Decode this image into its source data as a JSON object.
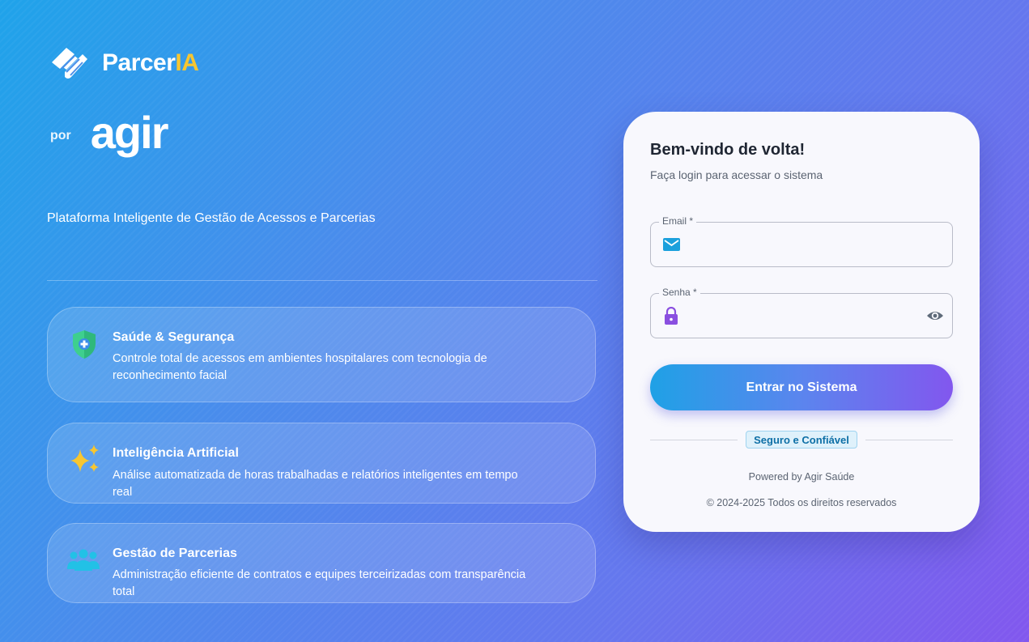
{
  "brand": {
    "name_main": "Parcer",
    "name_accent": "IA",
    "by_label": "por",
    "partner": "agir",
    "tagline": "Plataforma Inteligente de Gestão de Acessos e Parcerias"
  },
  "features": [
    {
      "icon": "shield-plus-icon",
      "title": "Saúde & Segurança",
      "description": "Controle total de acessos em ambientes hospitalares com tecnologia de reconhecimento facial"
    },
    {
      "icon": "sparkles-icon",
      "title": "Inteligência Artificial",
      "description": "Análise automatizada de horas trabalhadas e relatórios inteligentes em tempo real"
    },
    {
      "icon": "people-group-icon",
      "title": "Gestão de Parcerias",
      "description": "Administração eficiente de contratos e equipes terceirizadas com transparência total"
    }
  ],
  "login": {
    "title": "Bem-vindo de volta!",
    "subtitle": "Faça login para acessar o sistema",
    "email_label": "Email *",
    "email_value": "",
    "password_label": "Senha *",
    "password_value": "",
    "submit_label": "Entrar no Sistema",
    "secure_badge": "Seguro e Confiável",
    "powered_by": "Powered by Agir Saúde",
    "copyright": "© 2024-2025 Todos os direitos reservados"
  },
  "colors": {
    "gradient_start": "#1fa3ea",
    "gradient_end": "#8257ee",
    "brand_accent": "#f7c630",
    "email_icon": "#1ba0dc",
    "lock_icon": "#8a4fe0"
  }
}
